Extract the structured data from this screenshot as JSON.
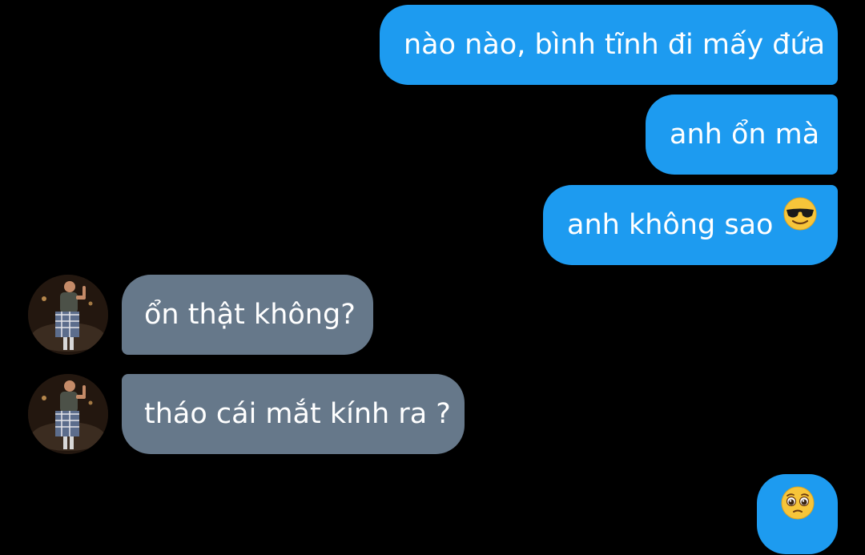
{
  "messages": [
    {
      "direction": "outgoing",
      "text": "nào nào, bình tĩnh đi mấy đứa"
    },
    {
      "direction": "outgoing",
      "text": "anh ổn mà"
    },
    {
      "direction": "outgoing",
      "text": "anh không sao",
      "emoji": "smiling-face-with-sunglasses-icon"
    },
    {
      "direction": "incoming",
      "text": "ổn thật không?"
    },
    {
      "direction": "incoming",
      "text": "tháo cái mắt kính ra ?"
    },
    {
      "direction": "outgoing",
      "text": "",
      "emoji": "pleading-face-icon"
    }
  ],
  "colors": {
    "background": "#000000",
    "outgoing_bubble": "#1d9bf0",
    "incoming_bubble": "#66788a",
    "text": "#ffffff"
  }
}
